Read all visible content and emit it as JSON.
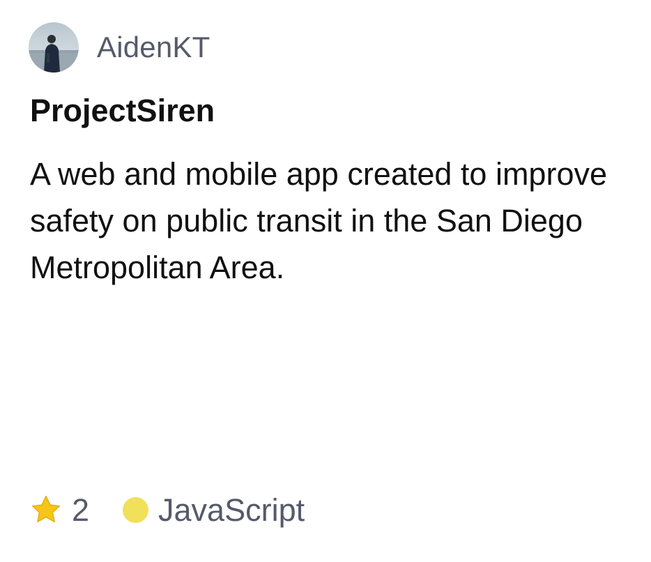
{
  "repo_card": {
    "owner": {
      "name": "AidenKT",
      "avatar_icon": "user-avatar-photo"
    },
    "name": "ProjectSiren",
    "description": "A web and mobile app created to improve safety on public transit in the San Diego Metropolitan Area.",
    "stars": {
      "icon": "star-icon",
      "count": "2",
      "icon_color": "#f5c518"
    },
    "language": {
      "name": "JavaScript",
      "color": "#f1e05a"
    }
  }
}
